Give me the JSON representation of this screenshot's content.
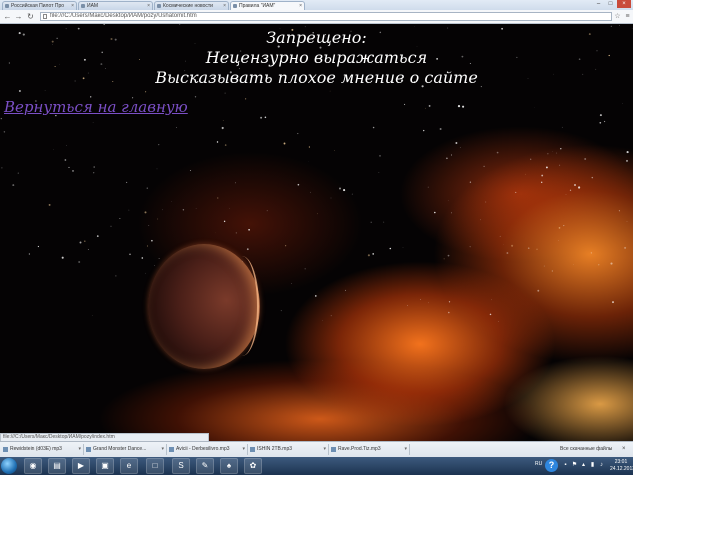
{
  "browser": {
    "tabs": [
      {
        "label": "Российская Пилот Про"
      },
      {
        "label": "ИАМ"
      },
      {
        "label": "Космические новости"
      },
      {
        "label": "Правила \"ИАМ\"",
        "active": true
      }
    ],
    "address": "file:///C:/Users/Макс/Desktop/ИАМ/pozy/Ushatomit.htm",
    "status_url": "file:///C:/Users/Макс/Desktop/ИАМ/pozy/index.htm"
  },
  "page": {
    "heading": "Запрещено:",
    "rules": [
      "Нецензурно выражаться",
      "Высказывать плохое мнение о сайте"
    ],
    "back_link": "Вернуться на главную"
  },
  "downloads": {
    "items": [
      {
        "label": "Rewidstein (d03E) mp3"
      },
      {
        "label": "Grand Monster Dance..."
      },
      {
        "label": "Avicii - Derbesilivro.mp3"
      },
      {
        "label": "ISHIN 2TB.mp3"
      },
      {
        "label": "Rave.Prod.Tiz.mp3"
      }
    ],
    "show_all": "Все скачанные файлы"
  },
  "taskbar": {
    "language": "RU",
    "time": "23:01",
    "date": "24.12.2013"
  },
  "icons": {
    "back": "arrow-left",
    "forward": "arrow-right",
    "reload": "reload",
    "star": "star",
    "menu": "hamburger"
  }
}
